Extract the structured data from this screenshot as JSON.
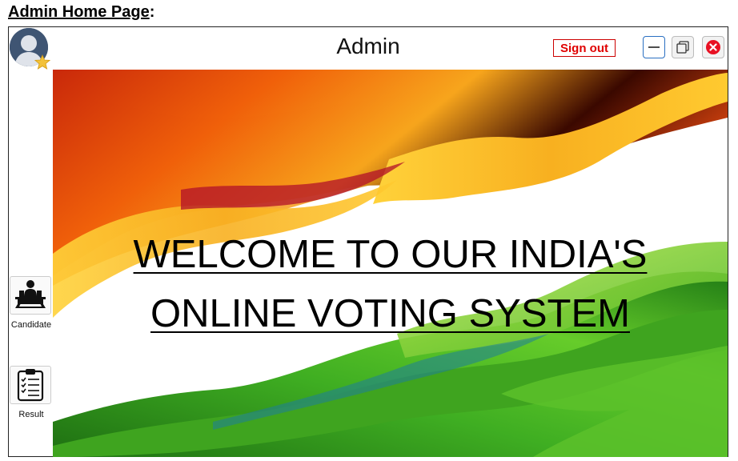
{
  "doc_heading": {
    "text": "Admin Home Page",
    "suffix": ":"
  },
  "window": {
    "title": "Admin",
    "sign_out_label": "Sign out",
    "controls": {
      "minimize_icon": "minimize-icon",
      "maximize_icon": "restore-icon",
      "close_icon": "close-icon"
    }
  },
  "sidebar": {
    "avatar_icon": "user-avatar-icon",
    "items": [
      {
        "label": "Candidate",
        "icon": "candidate-desk-icon"
      },
      {
        "label": "Result",
        "icon": "clipboard-checklist-icon"
      }
    ]
  },
  "banner": {
    "line1": "WELCOME TO OUR INDIA'S",
    "line2": "ONLINE VOTING SYSTEM",
    "colors": {
      "saffron": "#f26a0a",
      "white": "#ffffff",
      "green": "#2e9b1e"
    }
  }
}
